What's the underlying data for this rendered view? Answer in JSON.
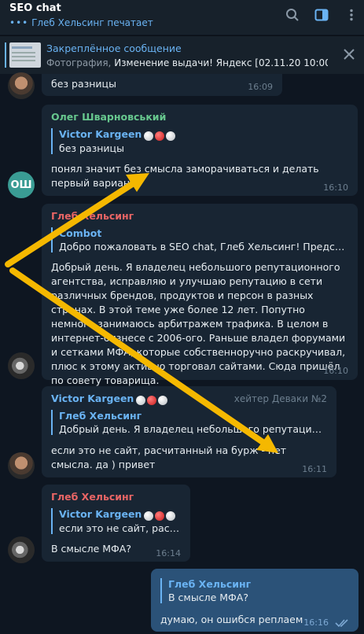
{
  "header": {
    "title": "SEO chat",
    "typing": "Глеб Хельсинг печатает",
    "icons": [
      "search-icon",
      "sidebar-toggle-icon",
      "more-vertical-icon"
    ]
  },
  "pinned": {
    "title": "Закреплённое сообщение",
    "prefix": "Фотография, ",
    "text": "Изменение выдачи! Яндекс [02.11.20 10:00..."
  },
  "messages": [
    {
      "text": "без разницы",
      "time": "16:09"
    },
    {
      "sender": "Олег Шварновський",
      "avatar_initials": "ОШ",
      "reply_name": "Victor Kargeen",
      "reply_text": "без разницы",
      "text": "понял значит без смысла заморачиваться и делать первый вариант",
      "time": "16:10"
    },
    {
      "sender": "Глеб Хельсинг",
      "reply_name": "Combot",
      "reply_text": "Добро пожаловать в SEO chat, Глеб Хельсинг! Представь...",
      "text": "Добрый день. Я владелец небольшого репутационного агентства, исправляю и улучшаю репутацию в сети различных брендов, продуктов и персон в разных странах. В этой теме уже более 12 лет. Попутно немного занимаюсь арбитражем трафика. В целом в интернет-бизнесе с 2006-ого. Раньше владел форумами и сетками МФА, которые собственноручно раскручивал, плюс к этому активно торговал сайтами. Сюда пришёл по совету товарища.",
      "time": "16:10"
    },
    {
      "sender": "Victor Kargeen",
      "badge": "хейтер Деваки №2",
      "reply_name": "Глеб Хельсинг",
      "reply_text": "Добрый день. Я владелец небольшого репутационн...",
      "text": "если это не сайт, расчитанный на бурж‌ - нет смысла. да ) привет",
      "time": "16:11"
    },
    {
      "sender": "Глеб Хельсинг",
      "reply_name": "Victor Kargeen",
      "reply_text": "если это не сайт, расчи...",
      "text": "В смысле МФА?",
      "time": "16:14"
    },
    {
      "reply_name": "Глеб Хельсинг",
      "reply_text": "В смысле МФА?",
      "text": "думаю, он ошибся реплаем",
      "time": "16:16",
      "status": "read"
    }
  ],
  "colors": {
    "background": "#0e1621",
    "incoming": "#182533",
    "outgoing": "#2b5278",
    "accent": "#6ab3f3",
    "annotation_arrow": "#f5b800"
  }
}
